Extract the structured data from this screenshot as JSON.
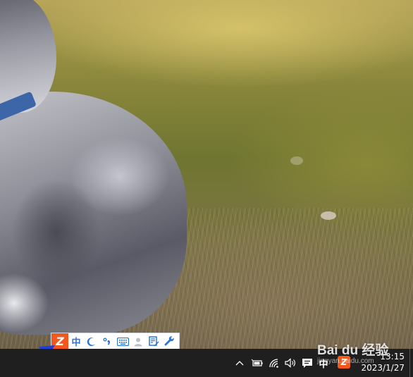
{
  "ime_toolbar": {
    "logo_glyph": "Z",
    "lang_label": "中",
    "buttons": [
      {
        "icon": "moon-icon",
        "label": "half-width"
      },
      {
        "icon": "punctuation-icon",
        "label": "°,"
      },
      {
        "icon": "keyboard-icon",
        "label": "soft-keyboard"
      },
      {
        "icon": "user-icon",
        "label": "account"
      },
      {
        "icon": "notepad-icon",
        "label": "notes"
      },
      {
        "icon": "wrench-icon",
        "label": "tools"
      }
    ],
    "brand_color": "#f2581d",
    "icon_color": "#2b74d8"
  },
  "taskbar": {
    "tray": {
      "ime_indicator": "中",
      "icons": [
        "chevron-up-icon",
        "battery-icon",
        "wifi-icon",
        "volume-icon",
        "notification-icon",
        "sogou-icon"
      ]
    },
    "clock": {
      "time": "13:15",
      "date": "2023/1/27"
    }
  },
  "watermark": {
    "text": "Bai du 经验",
    "sub": "jingyan.baidu.com"
  },
  "annotation": {
    "arrow_color": "#1f3fd6"
  }
}
